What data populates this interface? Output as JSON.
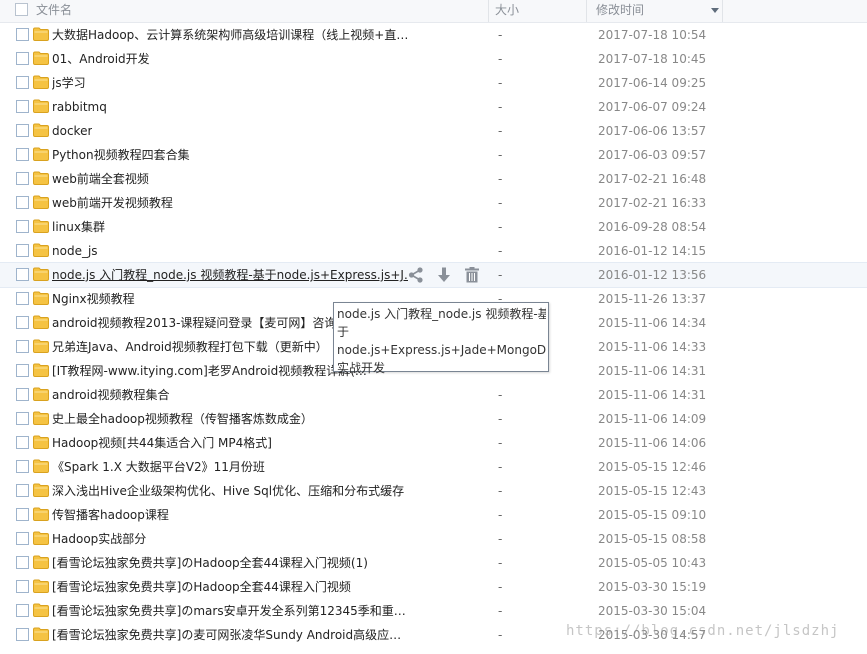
{
  "header": {
    "name_label": "文件名",
    "size_label": "大小",
    "date_label": "修改时间"
  },
  "files": [
    {
      "name": "大数据Hadoop、云计算系统架构师高级培训课程（线上视频+直…",
      "size": "-",
      "date": "2017-07-18 10:54"
    },
    {
      "name": "01、Android开发",
      "size": "-",
      "date": "2017-07-18 10:45"
    },
    {
      "name": "js学习",
      "size": "-",
      "date": "2017-06-14 09:25"
    },
    {
      "name": "rabbitmq",
      "size": "-",
      "date": "2017-06-07 09:24"
    },
    {
      "name": "docker",
      "size": "-",
      "date": "2017-06-06 13:57"
    },
    {
      "name": "Python视频教程四套合集",
      "size": "-",
      "date": "2017-06-03 09:57"
    },
    {
      "name": "web前端全套视频",
      "size": "-",
      "date": "2017-02-21 16:48"
    },
    {
      "name": "web前端开发视频教程",
      "size": "-",
      "date": "2017-02-21 16:33"
    },
    {
      "name": "linux集群",
      "size": "-",
      "date": "2016-09-28 08:54"
    },
    {
      "name": "node_js",
      "size": "-",
      "date": "2016-01-12 14:15"
    },
    {
      "name": "node.js 入门教程_node.js 视频教程-基于node.js+Express.js+J…",
      "size": "-",
      "date": "2016-01-12 13:56"
    },
    {
      "name": "Nginx视频教程",
      "size": "-",
      "date": "2015-11-26 13:37"
    },
    {
      "name": "android视频教程2013-课程疑问登录【麦可网】咨询",
      "size": "-",
      "date": "2015-11-06 14:34"
    },
    {
      "name": "兄弟连Java、Android视频教程打包下载（更新中）",
      "size": "-",
      "date": "2015-11-06 14:33"
    },
    {
      "name": "[IT教程网-www.itying.com]老罗Android视频教程详解(…",
      "size": "-",
      "date": "2015-11-06 14:31"
    },
    {
      "name": "android视频教程集合",
      "size": "-",
      "date": "2015-11-06 14:31"
    },
    {
      "name": "史上最全hadoop视频教程（传智播客炼数成金）",
      "size": "-",
      "date": "2015-11-06 14:09"
    },
    {
      "name": "Hadoop视频[共44集适合入门 MP4格式]",
      "size": "-",
      "date": "2015-11-06 14:06"
    },
    {
      "name": "《Spark 1.X 大数据平台V2》11月份班",
      "size": "-",
      "date": "2015-05-15 12:46"
    },
    {
      "name": "深入浅出Hive企业级架构优化、Hive Sql优化、压缩和分布式缓存",
      "size": "-",
      "date": "2015-05-15 12:43"
    },
    {
      "name": "传智播客hadoop课程",
      "size": "-",
      "date": "2015-05-15 09:10"
    },
    {
      "name": "Hadoop实战部分",
      "size": "-",
      "date": "2015-05-15 08:58"
    },
    {
      "name": "[看雪论坛独家免费共享]のHadoop全套44课程入门视频(1)",
      "size": "-",
      "date": "2015-05-05 10:43"
    },
    {
      "name": "[看雪论坛独家免费共享]のHadoop全套44课程入门视频",
      "size": "-",
      "date": "2015-03-30 15:19"
    },
    {
      "name": "[看雪论坛独家免费共享]のmars安卓开发全系列第12345季和重…",
      "size": "-",
      "date": "2015-03-30 15:04"
    },
    {
      "name": "[看雪论坛独家免费共享]の麦可网张凌华Sundy Android高级应…",
      "size": "-",
      "date": "2015-03-30 14:57"
    }
  ],
  "hover_row_index": 10,
  "tooltip": {
    "line1": "node.js 入门教程_node.js 视频教程-基",
    "line2": "于",
    "line3": "node.js+Express.js+Jade+MongoDB",
    "line4": "实战开发"
  },
  "icons": {
    "folder": "folder-icon",
    "share": "share-icon",
    "download": "download-icon",
    "delete": "trash-icon",
    "sort": "sort-desc-icon"
  },
  "colors": {
    "folder": "#f5c343",
    "icon_gray": "#8a9099",
    "checkbox_border": "#9fb4cc"
  },
  "watermark": "https://blog.csdn.net/jlsdzhj"
}
